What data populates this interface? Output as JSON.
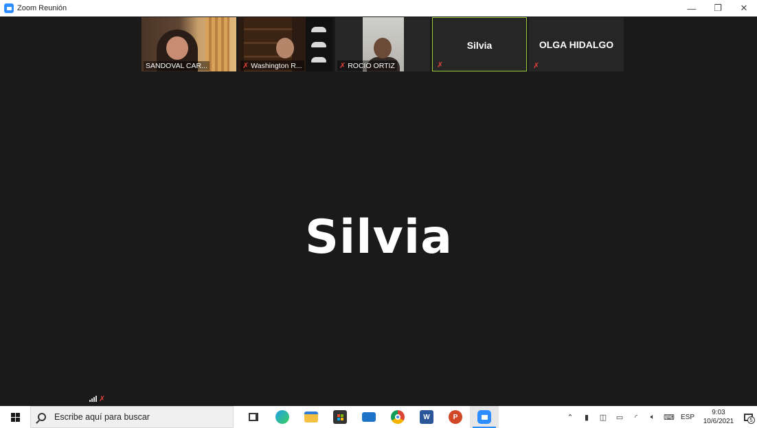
{
  "window": {
    "title": "Zoom Reunión",
    "controls": {
      "minimize": "—",
      "restore": "❐",
      "close": "✕"
    }
  },
  "meeting": {
    "tiles": [
      {
        "name": "SANDOVAL CAR...",
        "muted": false,
        "video": true
      },
      {
        "name": "Washington R...",
        "muted": true,
        "video": true
      },
      {
        "name": "ROCIO ORTIZ",
        "muted": true,
        "video": true
      },
      {
        "name": "Silvia",
        "muted": true,
        "video": false,
        "active_speaker": true
      },
      {
        "name": "OLGA HIDALGO",
        "muted": true,
        "video": false
      }
    ],
    "active_speaker_name": "Silvia"
  },
  "taskbar": {
    "search_placeholder": "Escribe aquí para buscar",
    "apps": [
      "task-view",
      "edge",
      "file-explorer",
      "store",
      "mail",
      "chrome",
      "word",
      "powerpoint",
      "zoom"
    ],
    "language": "ESP",
    "time": "9:03",
    "date": "10/6/2021",
    "notification_count": "5"
  },
  "colors": {
    "meeting_bg": "#1a1a1a",
    "active_border": "#9ccc3c",
    "mute_red": "#e0413a",
    "zoom_blue": "#2d8cff"
  }
}
